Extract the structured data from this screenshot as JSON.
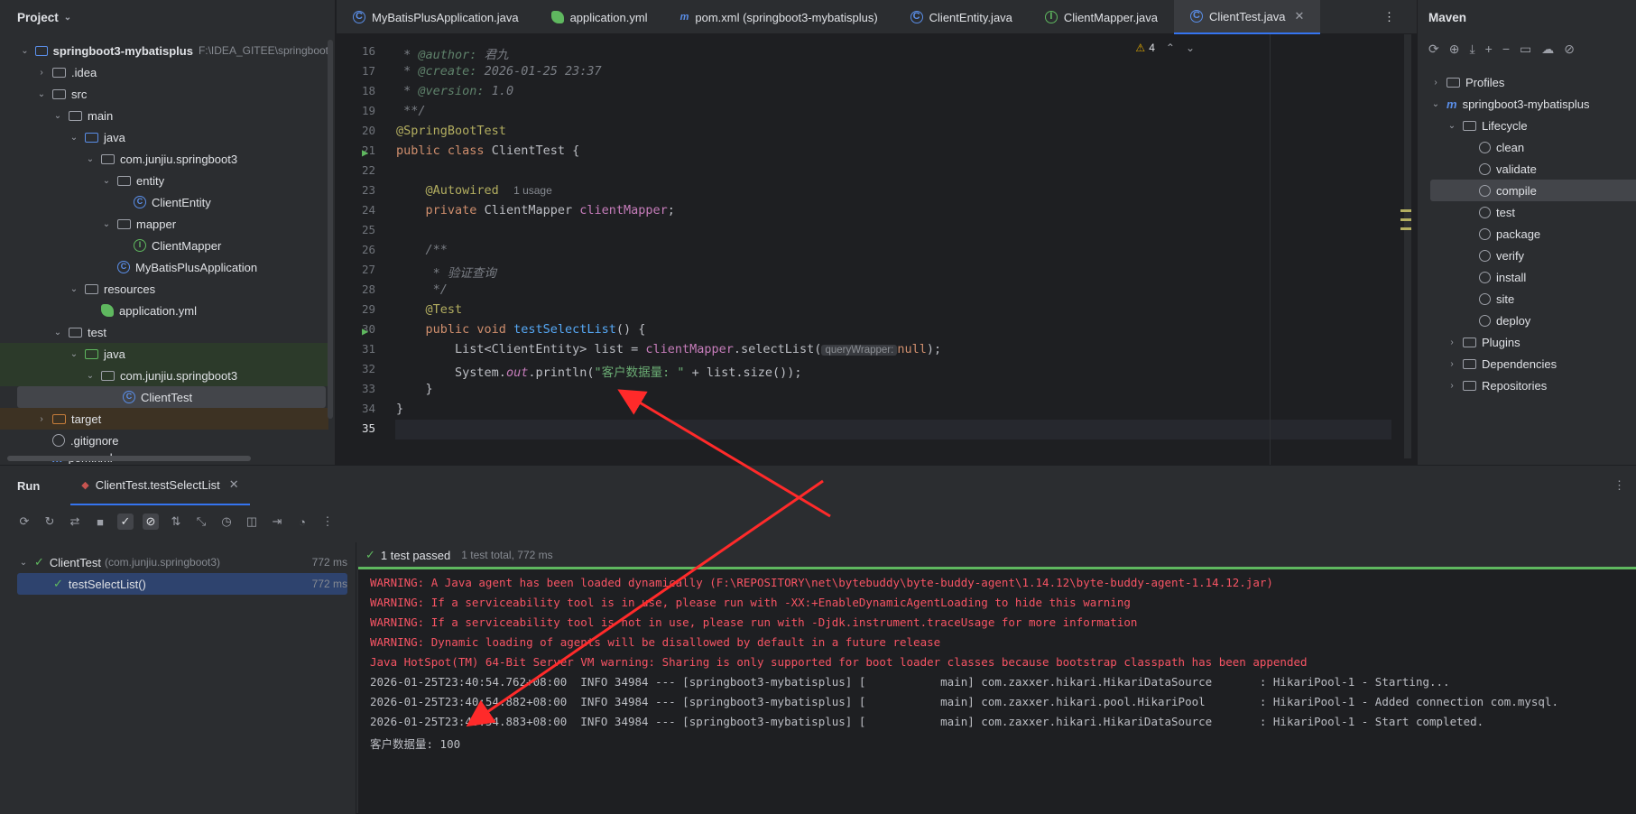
{
  "project_panel": {
    "title": "Project",
    "tree": [
      {
        "label": "springboot3-mybatisplus",
        "hint": "F:\\IDEA_GITEE\\springboot",
        "icon": "module-folder-icon"
      },
      {
        "label": ".idea",
        "icon": "folder-icon"
      },
      {
        "label": "src",
        "icon": "folder-icon"
      },
      {
        "label": "main",
        "icon": "folder-icon"
      },
      {
        "label": "java",
        "icon": "source-folder-icon"
      },
      {
        "label": "com.junjiu.springboot3",
        "icon": "package-icon"
      },
      {
        "label": "entity",
        "icon": "package-icon"
      },
      {
        "label": "ClientEntity",
        "icon": "class-icon"
      },
      {
        "label": "mapper",
        "icon": "package-icon"
      },
      {
        "label": "ClientMapper",
        "icon": "interface-icon"
      },
      {
        "label": "MyBatisPlusApplication",
        "icon": "class-icon"
      },
      {
        "label": "resources",
        "icon": "resources-folder-icon"
      },
      {
        "label": "application.yml",
        "icon": "spring-config-icon"
      },
      {
        "label": "test",
        "icon": "folder-icon"
      },
      {
        "label": "java",
        "icon": "test-source-folder-icon"
      },
      {
        "label": "com.junjiu.springboot3",
        "icon": "package-icon"
      },
      {
        "label": "ClientTest",
        "icon": "test-class-icon"
      },
      {
        "label": "target",
        "icon": "excluded-folder-icon"
      },
      {
        "label": ".gitignore",
        "icon": "ignore-file-icon"
      },
      {
        "label": "pom.xml",
        "icon": "maven-icon"
      }
    ]
  },
  "tabs": [
    {
      "label": "MyBatisPlusApplication.java",
      "icon": "class-icon"
    },
    {
      "label": "application.yml",
      "icon": "spring-config-icon"
    },
    {
      "label": "pom.xml (springboot3-mybatisplus)",
      "icon": "maven-icon"
    },
    {
      "label": "ClientEntity.java",
      "icon": "class-icon"
    },
    {
      "label": "ClientMapper.java",
      "icon": "interface-icon"
    },
    {
      "label": "ClientTest.java",
      "icon": "test-class-icon",
      "active": true
    }
  ],
  "editor": {
    "warnings": "4",
    "line_numbers": [
      "16",
      "17",
      "18",
      "19",
      "20",
      "21",
      "22",
      "23",
      "24",
      "25",
      "26",
      "27",
      "28",
      "29",
      "30",
      "31",
      "32",
      "33",
      "34",
      "35"
    ],
    "code": {
      "author_tag": "@author:",
      "author_val": "君九",
      "create_tag": "@create:",
      "create_val": "2026-01-25 23:37",
      "version_tag": "@version:",
      "version_val": "1.0",
      "doc_end": "**/",
      "annotation_sbt": "@SpringBootTest",
      "class_decl_kw": "public class",
      "class_name": "ClientTest {",
      "autowired": "@Autowired",
      "usage_hint": "1 usage",
      "field_kw": "private",
      "field_type": "ClientMapper",
      "field_name": "clientMapper",
      "doc_open": "/**",
      "doc_line": "* 验证查询",
      "doc_close": "*/",
      "test_ann": "@Test",
      "method_kw": "public void",
      "method_name": "testSelectList",
      "method_rest": "() {",
      "list_decl": "List<ClientEntity> list = ",
      "list_call": "clientMapper",
      "list_method": ".selectList(",
      "param_hint": "queryWrapper:",
      "list_null": "null",
      "list_end": ");",
      "print_start": "System.",
      "print_out": "out",
      "print_method": ".println(",
      "print_str": "\"客户数据量: \"",
      "print_rest": " + list.size());",
      "close_method": "}",
      "close_class": "}"
    }
  },
  "maven": {
    "title": "Maven",
    "project": "springboot3-mybatisplus",
    "profiles": "Profiles",
    "lifecycle": "Lifecycle",
    "phases": [
      "clean",
      "validate",
      "compile",
      "test",
      "package",
      "verify",
      "install",
      "site",
      "deploy"
    ],
    "selected_phase": "compile",
    "plugins": "Plugins",
    "dependencies": "Dependencies",
    "repositories": "Repositories"
  },
  "run": {
    "title": "Run",
    "config_tab": "ClientTest.testSelectList",
    "tests": [
      {
        "name": "ClientTest",
        "detail": "(com.junjiu.springboot3)",
        "time": "772 ms"
      },
      {
        "name": "testSelectList()",
        "detail": "",
        "time": "772 ms"
      }
    ],
    "status": "1 test passed",
    "status_detail": "1 test total, 772 ms",
    "console": [
      {
        "text": "WARNING: A Java agent has been loaded dynamically (F:\\REPOSITORY\\net\\bytebuddy\\byte-buddy-agent\\1.14.12\\byte-buddy-agent-1.14.12.jar)",
        "color": "red"
      },
      {
        "text": "WARNING: If a serviceability tool is in use, please run with -XX:+EnableDynamicAgentLoading to hide this warning",
        "color": "red"
      },
      {
        "text": "WARNING: If a serviceability tool is not in use, please run with -Djdk.instrument.traceUsage for more information",
        "color": "red"
      },
      {
        "text": "WARNING: Dynamic loading of agents will be disallowed by default in a future release",
        "color": "red"
      },
      {
        "text": "Java HotSpot(TM) 64-Bit Server VM warning: Sharing is only supported for boot loader classes because bootstrap classpath has been appended",
        "color": "red"
      },
      {
        "text": "2026-01-25T23:40:54.762+08:00  INFO 34984 --- [springboot3-mybatisplus] [           main] com.zaxxer.hikari.HikariDataSource       : HikariPool-1 - Starting...",
        "color": "white"
      },
      {
        "text": "2026-01-25T23:40:54.882+08:00  INFO 34984 --- [springboot3-mybatisplus] [           main] com.zaxxer.hikari.pool.HikariPool        : HikariPool-1 - Added connection com.mysql.",
        "color": "white"
      },
      {
        "text": "2026-01-25T23:40:54.883+08:00  INFO 34984 --- [springboot3-mybatisplus] [           main] com.zaxxer.hikari.HikariDataSource       : HikariPool-1 - Start completed.",
        "color": "white"
      },
      {
        "text": "客户数据量: 100",
        "color": "white"
      }
    ]
  },
  "colors": {
    "accent": "#3574f0",
    "arrow": "#ff2a2a",
    "warning": "#f75464",
    "pass": "#5fb85f"
  }
}
